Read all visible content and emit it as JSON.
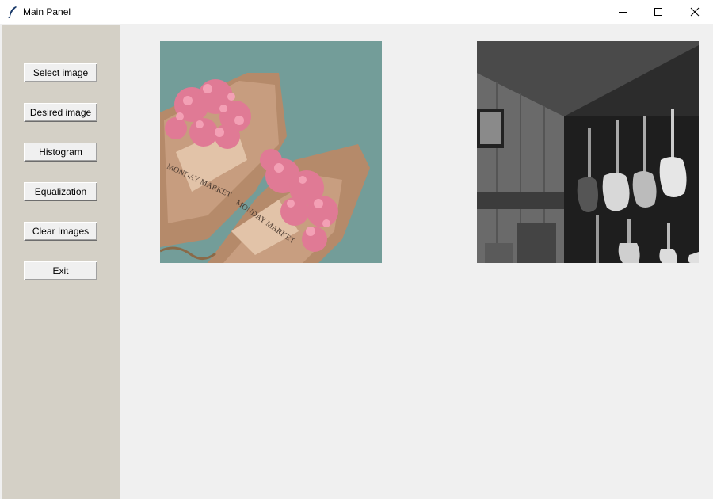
{
  "window": {
    "title": "Main Panel"
  },
  "sidebar": {
    "buttons": [
      {
        "label": "Select image"
      },
      {
        "label": "Desired image"
      },
      {
        "label": "Histogram"
      },
      {
        "label": "Equalization"
      },
      {
        "label": "Clear Images"
      },
      {
        "label": "Exit"
      }
    ]
  },
  "images": [
    {
      "kind": "photo-flower-bouquets",
      "lettering": "MONDAY MARKET"
    },
    {
      "kind": "photo-guitar-wall-grayscale"
    }
  ],
  "colors": {
    "sidebar": "#d4d0c6",
    "panel": "#f0f0f0",
    "titlebar": "#ffffff"
  }
}
